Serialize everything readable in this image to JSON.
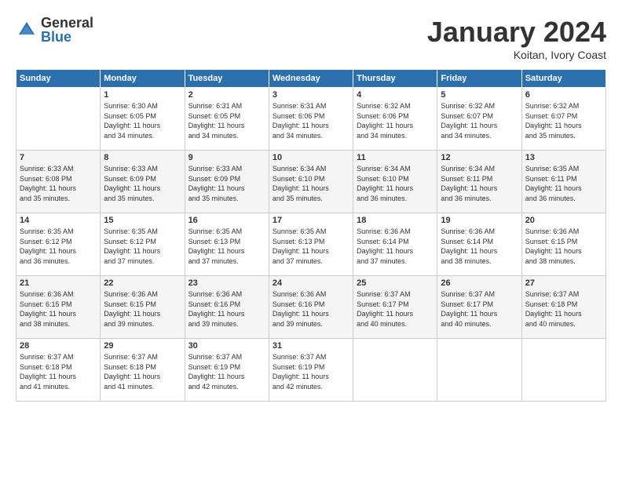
{
  "logo": {
    "general": "General",
    "blue": "Blue"
  },
  "title": "January 2024",
  "location": "Koitan, Ivory Coast",
  "days_header": [
    "Sunday",
    "Monday",
    "Tuesday",
    "Wednesday",
    "Thursday",
    "Friday",
    "Saturday"
  ],
  "weeks": [
    [
      {
        "day": "",
        "info": ""
      },
      {
        "day": "1",
        "info": "Sunrise: 6:30 AM\nSunset: 6:05 PM\nDaylight: 11 hours\nand 34 minutes."
      },
      {
        "day": "2",
        "info": "Sunrise: 6:31 AM\nSunset: 6:05 PM\nDaylight: 11 hours\nand 34 minutes."
      },
      {
        "day": "3",
        "info": "Sunrise: 6:31 AM\nSunset: 6:06 PM\nDaylight: 11 hours\nand 34 minutes."
      },
      {
        "day": "4",
        "info": "Sunrise: 6:32 AM\nSunset: 6:06 PM\nDaylight: 11 hours\nand 34 minutes."
      },
      {
        "day": "5",
        "info": "Sunrise: 6:32 AM\nSunset: 6:07 PM\nDaylight: 11 hours\nand 34 minutes."
      },
      {
        "day": "6",
        "info": "Sunrise: 6:32 AM\nSunset: 6:07 PM\nDaylight: 11 hours\nand 35 minutes."
      }
    ],
    [
      {
        "day": "7",
        "info": "Sunrise: 6:33 AM\nSunset: 6:08 PM\nDaylight: 11 hours\nand 35 minutes."
      },
      {
        "day": "8",
        "info": "Sunrise: 6:33 AM\nSunset: 6:09 PM\nDaylight: 11 hours\nand 35 minutes."
      },
      {
        "day": "9",
        "info": "Sunrise: 6:33 AM\nSunset: 6:09 PM\nDaylight: 11 hours\nand 35 minutes."
      },
      {
        "day": "10",
        "info": "Sunrise: 6:34 AM\nSunset: 6:10 PM\nDaylight: 11 hours\nand 35 minutes."
      },
      {
        "day": "11",
        "info": "Sunrise: 6:34 AM\nSunset: 6:10 PM\nDaylight: 11 hours\nand 36 minutes."
      },
      {
        "day": "12",
        "info": "Sunrise: 6:34 AM\nSunset: 6:11 PM\nDaylight: 11 hours\nand 36 minutes."
      },
      {
        "day": "13",
        "info": "Sunrise: 6:35 AM\nSunset: 6:11 PM\nDaylight: 11 hours\nand 36 minutes."
      }
    ],
    [
      {
        "day": "14",
        "info": "Sunrise: 6:35 AM\nSunset: 6:12 PM\nDaylight: 11 hours\nand 36 minutes."
      },
      {
        "day": "15",
        "info": "Sunrise: 6:35 AM\nSunset: 6:12 PM\nDaylight: 11 hours\nand 37 minutes."
      },
      {
        "day": "16",
        "info": "Sunrise: 6:35 AM\nSunset: 6:13 PM\nDaylight: 11 hours\nand 37 minutes."
      },
      {
        "day": "17",
        "info": "Sunrise: 6:35 AM\nSunset: 6:13 PM\nDaylight: 11 hours\nand 37 minutes."
      },
      {
        "day": "18",
        "info": "Sunrise: 6:36 AM\nSunset: 6:14 PM\nDaylight: 11 hours\nand 37 minutes."
      },
      {
        "day": "19",
        "info": "Sunrise: 6:36 AM\nSunset: 6:14 PM\nDaylight: 11 hours\nand 38 minutes."
      },
      {
        "day": "20",
        "info": "Sunrise: 6:36 AM\nSunset: 6:15 PM\nDaylight: 11 hours\nand 38 minutes."
      }
    ],
    [
      {
        "day": "21",
        "info": "Sunrise: 6:36 AM\nSunset: 6:15 PM\nDaylight: 11 hours\nand 38 minutes."
      },
      {
        "day": "22",
        "info": "Sunrise: 6:36 AM\nSunset: 6:15 PM\nDaylight: 11 hours\nand 39 minutes."
      },
      {
        "day": "23",
        "info": "Sunrise: 6:36 AM\nSunset: 6:16 PM\nDaylight: 11 hours\nand 39 minutes."
      },
      {
        "day": "24",
        "info": "Sunrise: 6:36 AM\nSunset: 6:16 PM\nDaylight: 11 hours\nand 39 minutes."
      },
      {
        "day": "25",
        "info": "Sunrise: 6:37 AM\nSunset: 6:17 PM\nDaylight: 11 hours\nand 40 minutes."
      },
      {
        "day": "26",
        "info": "Sunrise: 6:37 AM\nSunset: 6:17 PM\nDaylight: 11 hours\nand 40 minutes."
      },
      {
        "day": "27",
        "info": "Sunrise: 6:37 AM\nSunset: 6:18 PM\nDaylight: 11 hours\nand 40 minutes."
      }
    ],
    [
      {
        "day": "28",
        "info": "Sunrise: 6:37 AM\nSunset: 6:18 PM\nDaylight: 11 hours\nand 41 minutes."
      },
      {
        "day": "29",
        "info": "Sunrise: 6:37 AM\nSunset: 6:18 PM\nDaylight: 11 hours\nand 41 minutes."
      },
      {
        "day": "30",
        "info": "Sunrise: 6:37 AM\nSunset: 6:19 PM\nDaylight: 11 hours\nand 42 minutes."
      },
      {
        "day": "31",
        "info": "Sunrise: 6:37 AM\nSunset: 6:19 PM\nDaylight: 11 hours\nand 42 minutes."
      },
      {
        "day": "",
        "info": ""
      },
      {
        "day": "",
        "info": ""
      },
      {
        "day": "",
        "info": ""
      }
    ]
  ]
}
